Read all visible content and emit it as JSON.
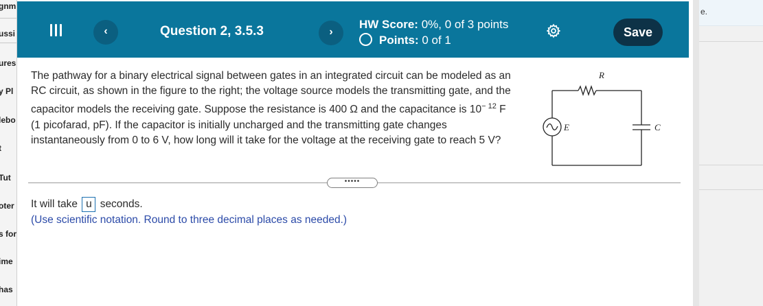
{
  "sidebar": {
    "fragments": [
      "gnm",
      "ussi",
      "ures",
      "y Pl",
      "lebo",
      "t",
      "Tut",
      "oter",
      "s for",
      "ime",
      "has"
    ]
  },
  "right_fragment": "e.",
  "header": {
    "menu_icon": "hamburger-menu-icon",
    "prev_label": "‹",
    "question_title": "Question 2, 3.5.3",
    "next_label": "›",
    "hw_score_label": "HW Score:",
    "hw_score_value": "0%, 0 of 3 points",
    "points_label": "Points:",
    "points_value": "0 of 1",
    "settings_icon": "gear-icon",
    "save_label": "Save"
  },
  "question": {
    "part1": "The pathway for a binary electrical signal between gates in an integrated circuit can be modeled as an RC circuit, as shown in the figure to the right; the voltage source models the transmitting gate, and the capacitor models the receiving gate. Suppose the resistance is 400 Ω and the capacitance is 10",
    "exponent": "− 12",
    "part2": " F (1 picofarad, pF). If the capacitor is initially uncharged and the transmitting gate changes instantaneously from 0 to 6 V, how long will it take for the voltage at the receiving gate to reach 5 V?"
  },
  "figure": {
    "r_label": "R",
    "e_label": "E",
    "c_label": "C"
  },
  "expand_label": "•••••",
  "answer": {
    "prefix": "It will take",
    "value": "u",
    "suffix": "seconds."
  },
  "hint": "(Use scientific notation. Round to three decimal places as needed.)",
  "colors": {
    "header": "#0a769c",
    "save_button": "#0d3247",
    "hint_text": "#2b4aa8"
  }
}
